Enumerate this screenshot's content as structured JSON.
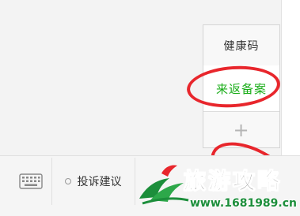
{
  "menu": {
    "items": [
      {
        "label": "健康码"
      },
      {
        "label": "来返备案"
      },
      {
        "label": "+"
      }
    ]
  },
  "bottom_bar": {
    "keyboard_icon": "keyboard-icon",
    "complaint_label": "投诉建议"
  },
  "watermark": {
    "title": "旅游攻略",
    "url": "www.1681989.cn",
    "brand_color": "#1c8e3b"
  },
  "colors": {
    "accent_green": "#1aad19",
    "annotation_red": "#e8262c"
  }
}
